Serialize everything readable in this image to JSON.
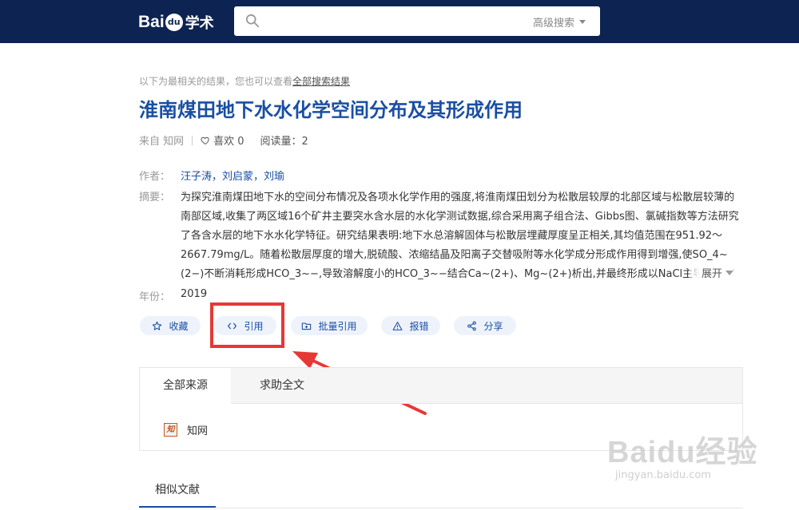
{
  "header": {
    "logo_text": "Bai",
    "logo_paw": "du",
    "logo_suffix": "学术",
    "search_value": "",
    "advanced_search": "高级搜索"
  },
  "result_hint": {
    "text": "以下为最相关的结果，您也可以查看",
    "link": "全部搜索结果"
  },
  "paper": {
    "title": "淮南煤田地下水水化学空间分布及其形成作用",
    "source_label": "来自 知网",
    "likes_label": "喜欢 0",
    "reads_label": "阅读量：2",
    "authors_label": "作者：",
    "authors": "汪子涛，刘启蒙，刘瑜",
    "abstract_label": "摘要：",
    "abstract": "为探究淮南煤田地下水的空间分布情况及各项水化学作用的强度,将淮南煤田划分为松散层较厚的北部区域与松散层较薄的南部区域,收集了两区域16个矿井主要突水含水层的水化学测试数据,综合采用离子组合法、Gibbs图、氯碱指数等方法研究了各含水层的地下水水化学特征。研究结果表明:地下水总溶解固体与松散层埋藏厚度呈正相关,其均值范围在951.92～2667.79mg/L。随着松散层厚度的增大,脱硫酸、浓缩结晶及阳离子交替吸附等水化学成分形成作用得到增强,使SO_4~(2−)不断消耗形成HCO_3~−,导致溶解度小的HCO_3~−结合Ca~(2+)、Mg~(2+)析出,并最终形成以NaCl主导的高矿化度",
    "expand_label": "展开",
    "year_label": "年份：",
    "year": "2019"
  },
  "actions": {
    "collect": "收藏",
    "cite": "引用",
    "batch_cite": "批量引用",
    "report": "报错",
    "share": "分享"
  },
  "sources_panel": {
    "tabs": [
      "全部来源",
      "求助全文"
    ],
    "source_icon_text": "知",
    "source_name": "知网"
  },
  "similar": {
    "tab": "相似文献"
  },
  "watermark": {
    "line1": "Baidu经验",
    "line2": "jingyan.baidu.com"
  },
  "colors": {
    "header_bg": "#0d2452",
    "title_blue": "#1a4fa3",
    "button_bg": "#eef3fb",
    "highlight_red": "#e53935"
  }
}
